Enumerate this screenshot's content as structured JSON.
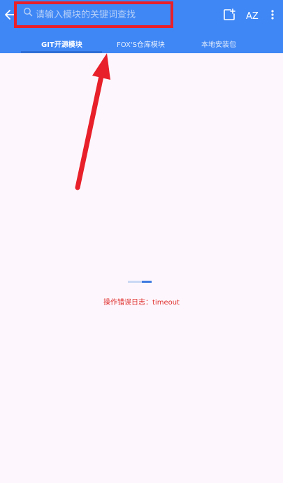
{
  "toolbar": {
    "back_icon": "arrow-back-icon",
    "search_icon": "search-icon",
    "search_placeholder": "请输入模块的关键词查找",
    "actions": [
      {
        "icon": "add-note-icon"
      },
      {
        "icon": "sort-az-icon",
        "label": "AZ"
      },
      {
        "icon": "more-vert-icon"
      }
    ]
  },
  "tabs": [
    {
      "label": "GIT开源模块",
      "active": true
    },
    {
      "label": "FOX'S仓库模块",
      "active": false
    },
    {
      "label": "本地安装包",
      "active": false
    }
  ],
  "status": {
    "progress": 0.4,
    "error_message": "操作错误日志：timeout"
  },
  "colors": {
    "header": "#3f87f5",
    "background": "#fdf7fd",
    "annotation": "#e8202a",
    "error": "#e0302e"
  }
}
